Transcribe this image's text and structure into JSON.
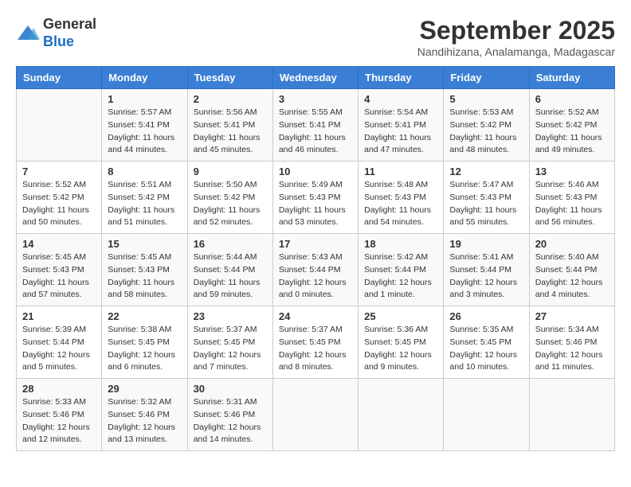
{
  "header": {
    "logo_general": "General",
    "logo_blue": "Blue",
    "month_year": "September 2025",
    "location": "Nandihizana, Analamanga, Madagascar"
  },
  "days_of_week": [
    "Sunday",
    "Monday",
    "Tuesday",
    "Wednesday",
    "Thursday",
    "Friday",
    "Saturday"
  ],
  "weeks": [
    [
      {
        "day": "",
        "info": ""
      },
      {
        "day": "1",
        "info": "Sunrise: 5:57 AM\nSunset: 5:41 PM\nDaylight: 11 hours\nand 44 minutes."
      },
      {
        "day": "2",
        "info": "Sunrise: 5:56 AM\nSunset: 5:41 PM\nDaylight: 11 hours\nand 45 minutes."
      },
      {
        "day": "3",
        "info": "Sunrise: 5:55 AM\nSunset: 5:41 PM\nDaylight: 11 hours\nand 46 minutes."
      },
      {
        "day": "4",
        "info": "Sunrise: 5:54 AM\nSunset: 5:41 PM\nDaylight: 11 hours\nand 47 minutes."
      },
      {
        "day": "5",
        "info": "Sunrise: 5:53 AM\nSunset: 5:42 PM\nDaylight: 11 hours\nand 48 minutes."
      },
      {
        "day": "6",
        "info": "Sunrise: 5:52 AM\nSunset: 5:42 PM\nDaylight: 11 hours\nand 49 minutes."
      }
    ],
    [
      {
        "day": "7",
        "info": "Sunrise: 5:52 AM\nSunset: 5:42 PM\nDaylight: 11 hours\nand 50 minutes."
      },
      {
        "day": "8",
        "info": "Sunrise: 5:51 AM\nSunset: 5:42 PM\nDaylight: 11 hours\nand 51 minutes."
      },
      {
        "day": "9",
        "info": "Sunrise: 5:50 AM\nSunset: 5:42 PM\nDaylight: 11 hours\nand 52 minutes."
      },
      {
        "day": "10",
        "info": "Sunrise: 5:49 AM\nSunset: 5:43 PM\nDaylight: 11 hours\nand 53 minutes."
      },
      {
        "day": "11",
        "info": "Sunrise: 5:48 AM\nSunset: 5:43 PM\nDaylight: 11 hours\nand 54 minutes."
      },
      {
        "day": "12",
        "info": "Sunrise: 5:47 AM\nSunset: 5:43 PM\nDaylight: 11 hours\nand 55 minutes."
      },
      {
        "day": "13",
        "info": "Sunrise: 5:46 AM\nSunset: 5:43 PM\nDaylight: 11 hours\nand 56 minutes."
      }
    ],
    [
      {
        "day": "14",
        "info": "Sunrise: 5:45 AM\nSunset: 5:43 PM\nDaylight: 11 hours\nand 57 minutes."
      },
      {
        "day": "15",
        "info": "Sunrise: 5:45 AM\nSunset: 5:43 PM\nDaylight: 11 hours\nand 58 minutes."
      },
      {
        "day": "16",
        "info": "Sunrise: 5:44 AM\nSunset: 5:44 PM\nDaylight: 11 hours\nand 59 minutes."
      },
      {
        "day": "17",
        "info": "Sunrise: 5:43 AM\nSunset: 5:44 PM\nDaylight: 12 hours\nand 0 minutes."
      },
      {
        "day": "18",
        "info": "Sunrise: 5:42 AM\nSunset: 5:44 PM\nDaylight: 12 hours\nand 1 minute."
      },
      {
        "day": "19",
        "info": "Sunrise: 5:41 AM\nSunset: 5:44 PM\nDaylight: 12 hours\nand 3 minutes."
      },
      {
        "day": "20",
        "info": "Sunrise: 5:40 AM\nSunset: 5:44 PM\nDaylight: 12 hours\nand 4 minutes."
      }
    ],
    [
      {
        "day": "21",
        "info": "Sunrise: 5:39 AM\nSunset: 5:44 PM\nDaylight: 12 hours\nand 5 minutes."
      },
      {
        "day": "22",
        "info": "Sunrise: 5:38 AM\nSunset: 5:45 PM\nDaylight: 12 hours\nand 6 minutes."
      },
      {
        "day": "23",
        "info": "Sunrise: 5:37 AM\nSunset: 5:45 PM\nDaylight: 12 hours\nand 7 minutes."
      },
      {
        "day": "24",
        "info": "Sunrise: 5:37 AM\nSunset: 5:45 PM\nDaylight: 12 hours\nand 8 minutes."
      },
      {
        "day": "25",
        "info": "Sunrise: 5:36 AM\nSunset: 5:45 PM\nDaylight: 12 hours\nand 9 minutes."
      },
      {
        "day": "26",
        "info": "Sunrise: 5:35 AM\nSunset: 5:45 PM\nDaylight: 12 hours\nand 10 minutes."
      },
      {
        "day": "27",
        "info": "Sunrise: 5:34 AM\nSunset: 5:46 PM\nDaylight: 12 hours\nand 11 minutes."
      }
    ],
    [
      {
        "day": "28",
        "info": "Sunrise: 5:33 AM\nSunset: 5:46 PM\nDaylight: 12 hours\nand 12 minutes."
      },
      {
        "day": "29",
        "info": "Sunrise: 5:32 AM\nSunset: 5:46 PM\nDaylight: 12 hours\nand 13 minutes."
      },
      {
        "day": "30",
        "info": "Sunrise: 5:31 AM\nSunset: 5:46 PM\nDaylight: 12 hours\nand 14 minutes."
      },
      {
        "day": "",
        "info": ""
      },
      {
        "day": "",
        "info": ""
      },
      {
        "day": "",
        "info": ""
      },
      {
        "day": "",
        "info": ""
      }
    ]
  ]
}
